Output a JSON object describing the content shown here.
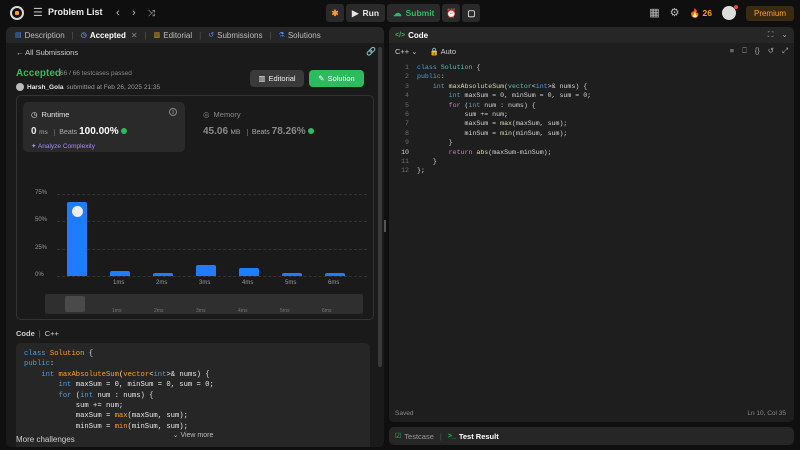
{
  "topbar": {
    "problem_list": "Problem List",
    "run": "Run",
    "submit": "Submit",
    "streak": "26",
    "premium": "Premium"
  },
  "left_tabs": [
    {
      "label": "Description",
      "icon": "description-icon"
    },
    {
      "label": "Accepted",
      "icon": "clock-icon",
      "closable": true
    },
    {
      "label": "Editorial",
      "icon": "book-icon"
    },
    {
      "label": "Submissions",
      "icon": "history-icon"
    },
    {
      "label": "Solutions",
      "icon": "flask-icon"
    }
  ],
  "submission": {
    "back_label": "All Submissions",
    "status": "Accepted",
    "passed": "66 / 66 testcases passed",
    "user": "Harsh_Gola",
    "submitted": "submitted at Feb 26, 2025 21:35",
    "editorial_btn": "Editorial",
    "solution_btn": "Solution"
  },
  "runtime": {
    "title": "Runtime",
    "value": "0",
    "unit": "ms",
    "beats_label": "Beats",
    "beats": "100.00%",
    "analyze": "Analyze Complexity"
  },
  "memory": {
    "title": "Memory",
    "value": "45.06",
    "unit": "MB",
    "beats_label": "Beats",
    "beats": "78.26%"
  },
  "chart_data": {
    "type": "bar",
    "categories": [
      "0ms",
      "1ms",
      "2ms",
      "3ms",
      "4ms",
      "5ms",
      "6ms"
    ],
    "values": [
      68,
      5,
      3,
      10,
      7,
      3,
      3
    ],
    "ylim": [
      0,
      75
    ],
    "yticks": [
      "75%",
      "50%",
      "25%",
      "0%"
    ],
    "xtick_labels": [
      "1ms",
      "2ms",
      "3ms",
      "4ms",
      "5ms",
      "6ms"
    ],
    "minimap_labels": [
      "1ms",
      "2ms",
      "3ms",
      "4ms",
      "5ms",
      "6ms"
    ],
    "bar_color": "#1f7cff",
    "highlight_index": 0
  },
  "code_section": {
    "label": "Code",
    "lang": "C++",
    "lines": [
      "class Solution {",
      "public:",
      "    int maxAbsoluteSum(vector<int>& nums) {",
      "        int maxSum = 0, minSum = 0, sum = 0;",
      "        for (int num : nums) {",
      "            sum += num;",
      "            maxSum = max(maxSum, sum);",
      "            minSum = min(minSum, sum);"
    ],
    "view_more": "View more",
    "more_challenges": "More challenges"
  },
  "editor": {
    "tab_label": "Code",
    "language": "C++",
    "mode": "Auto",
    "status": "Saved",
    "cursor": "Ln 10, Col 35",
    "current_line": 10
  },
  "bottom": {
    "testcase": "Testcase",
    "test_result": "Test Result"
  }
}
